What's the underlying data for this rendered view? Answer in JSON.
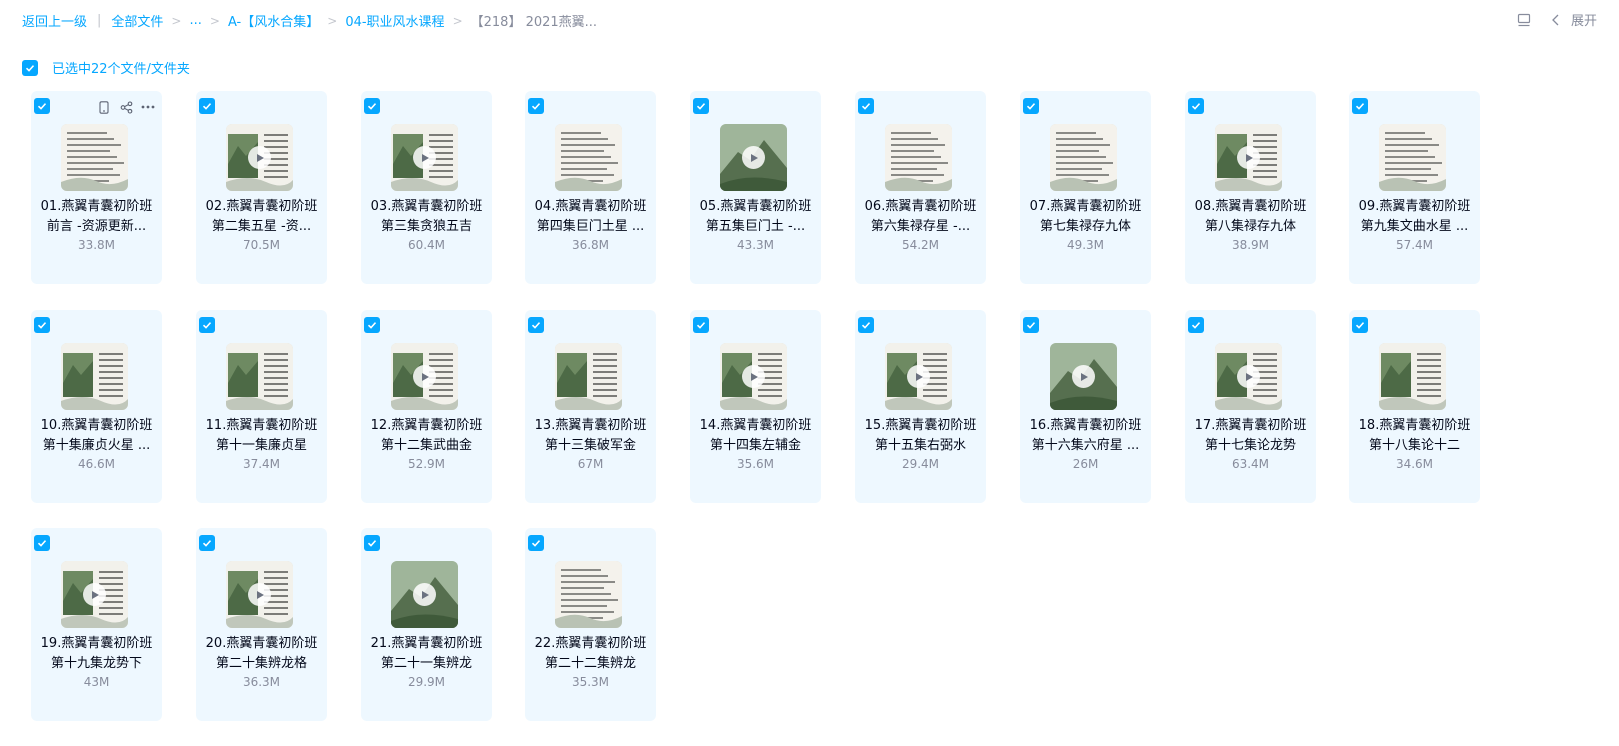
{
  "breadcrumb": {
    "back": "返回上一级",
    "all_files": "全部文件",
    "ellipsis": "...",
    "folder1": "A-【风水合集】",
    "folder2": "04-职业风水课程",
    "current": "【218】 2021燕翼..."
  },
  "toolbar": {
    "expand_label": "展开"
  },
  "selection": {
    "label": "已选中22个文件/文件夹"
  },
  "files": [
    {
      "line1": "01.燕翼青囊初阶班",
      "line2": "前言 -资源更新...",
      "size": "33.8M",
      "is_video": false,
      "thumb": "doc"
    },
    {
      "line1": "02.燕翼青囊初阶班",
      "line2": "第二集五星 -资...",
      "size": "70.5M",
      "is_video": true,
      "thumb": "mixed"
    },
    {
      "line1": "03.燕翼青囊初阶班",
      "line2": "第三集贪狼五吉",
      "size": "60.4M",
      "is_video": true,
      "thumb": "mixed"
    },
    {
      "line1": "04.燕翼青囊初阶班",
      "line2": "第四集巨门土星 ...",
      "size": "36.8M",
      "is_video": false,
      "thumb": "doc"
    },
    {
      "line1": "05.燕翼青囊初阶班",
      "line2": "第五集巨门土 -...",
      "size": "43.3M",
      "is_video": true,
      "thumb": "mountain"
    },
    {
      "line1": "06.燕翼青囊初阶班",
      "line2": "第六集禄存星 -...",
      "size": "54.2M",
      "is_video": false,
      "thumb": "doc"
    },
    {
      "line1": "07.燕翼青囊初阶班",
      "line2": "第七集禄存九体",
      "size": "49.3M",
      "is_video": false,
      "thumb": "doc"
    },
    {
      "line1": "08.燕翼青囊初阶班",
      "line2": "第八集禄存九体",
      "size": "38.9M",
      "is_video": true,
      "thumb": "mixed"
    },
    {
      "line1": "09.燕翼青囊初阶班",
      "line2": "第九集文曲水星 ...",
      "size": "57.4M",
      "is_video": false,
      "thumb": "doc"
    },
    {
      "line1": "10.燕翼青囊初阶班",
      "line2": "第十集廉贞火星 ...",
      "size": "46.6M",
      "is_video": false,
      "thumb": "mixed"
    },
    {
      "line1": "11.燕翼青囊初阶班",
      "line2": "第十一集廉贞星",
      "size": "37.4M",
      "is_video": false,
      "thumb": "mixed"
    },
    {
      "line1": "12.燕翼青囊初阶班",
      "line2": "第十二集武曲金",
      "size": "52.9M",
      "is_video": true,
      "thumb": "mixed"
    },
    {
      "line1": "13.燕翼青囊初阶班",
      "line2": "第十三集破军金",
      "size": "67M",
      "is_video": false,
      "thumb": "mixed"
    },
    {
      "line1": "14.燕翼青囊初阶班",
      "line2": "第十四集左辅金",
      "size": "35.6M",
      "is_video": true,
      "thumb": "mixed"
    },
    {
      "line1": "15.燕翼青囊初阶班",
      "line2": "第十五集右弼水",
      "size": "29.4M",
      "is_video": true,
      "thumb": "mixed"
    },
    {
      "line1": "16.燕翼青囊初阶班",
      "line2": "第十六集六府星 ...",
      "size": "26M",
      "is_video": true,
      "thumb": "mountain"
    },
    {
      "line1": "17.燕翼青囊初阶班",
      "line2": "第十七集论龙势",
      "size": "63.4M",
      "is_video": true,
      "thumb": "mixed"
    },
    {
      "line1": "18.燕翼青囊初阶班",
      "line2": "第十八集论十二",
      "size": "34.6M",
      "is_video": false,
      "thumb": "mixed"
    },
    {
      "line1": "19.燕翼青囊初阶班",
      "line2": "第十九集龙势下",
      "size": "43M",
      "is_video": true,
      "thumb": "mixed"
    },
    {
      "line1": "20.燕翼青囊初阶班",
      "line2": "第二十集辨龙格",
      "size": "36.3M",
      "is_video": true,
      "thumb": "mixed"
    },
    {
      "line1": "21.燕翼青囊初阶班",
      "line2": "第二十一集辨龙",
      "size": "29.9M",
      "is_video": true,
      "thumb": "mountain"
    },
    {
      "line1": "22.燕翼青囊初阶班",
      "line2": "第二十二集辨龙",
      "size": "35.3M",
      "is_video": false,
      "thumb": "doc"
    }
  ],
  "colors": {
    "accent": "#06a7ff",
    "card_bg": "#eef8ff",
    "muted": "#878c9c"
  }
}
